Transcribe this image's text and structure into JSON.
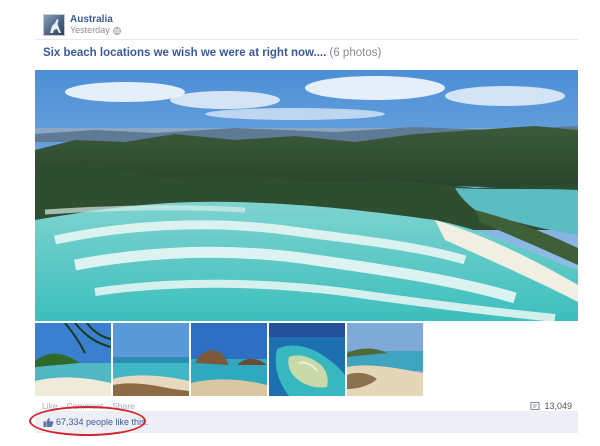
{
  "post": {
    "author": "Australia",
    "timestamp": "Yesterday",
    "audience_icon": "globe-icon",
    "title": "Six beach locations we wish we were at right now....",
    "photo_count": "(6 photos)"
  },
  "photos": {
    "main": "whitehaven-beach-aerial",
    "thumbnails": [
      "palm-beach-cove",
      "turquoise-bay",
      "rocky-island-beach",
      "coral-reef-aerial",
      "sandy-headland"
    ]
  },
  "actions": {
    "like": "Like",
    "separator": "·",
    "comment": "Comment",
    "share": "Share"
  },
  "share_count": "13,049",
  "likes": {
    "text": "67,334 people like this."
  },
  "colors": {
    "link_blue": "#3b5998",
    "likes_bg": "#edeff4",
    "highlight_red": "#d3252c"
  }
}
